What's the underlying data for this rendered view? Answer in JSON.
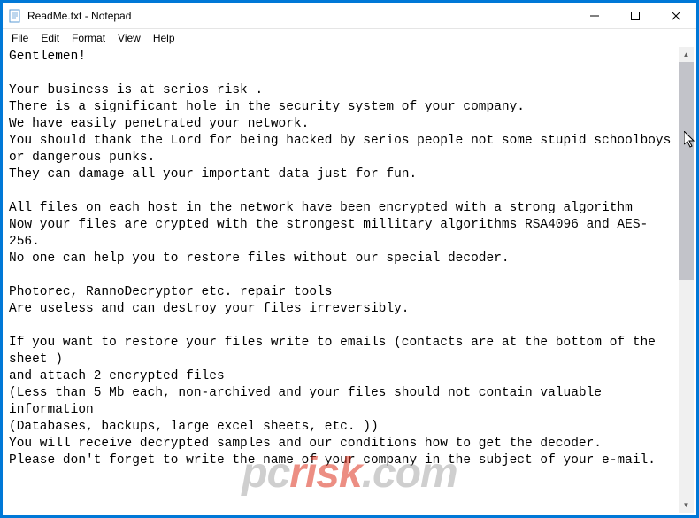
{
  "window": {
    "title": "ReadMe.txt - Notepad"
  },
  "menu": {
    "file": "File",
    "edit": "Edit",
    "format": "Format",
    "view": "View",
    "help": "Help"
  },
  "content": {
    "text": "Gentlemen!\n\nYour business is at serios risk .\nThere is a significant hole in the security system of your company.\nWe have easily penetrated your network.\nYou should thank the Lord for being hacked by serios people not some stupid schoolboys or dangerous punks.\nThey can damage all your important data just for fun.\n\nAll files on each host in the network have been encrypted with a strong algorithm\nNow your files are crypted with the strongest millitary algorithms RSA4096 and AES-256.\nNo one can help you to restore files without our special decoder.\n\nPhotorec, RannoDecryptor etc. repair tools\nAre useless and can destroy your files irreversibly.\n\nIf you want to restore your files write to emails (contacts are at the bottom of the sheet )\nand attach 2 encrypted files\n(Less than 5 Mb each, non-archived and your files should not contain valuable information\n(Databases, backups, large excel sheets, etc. ))\nYou will receive decrypted samples and our conditions how to get the decoder.\nPlease don't forget to write the name of your company in the subject of your e-mail."
  },
  "watermark": {
    "prefix": "pc",
    "main": "risk",
    "suffix": ".com"
  }
}
